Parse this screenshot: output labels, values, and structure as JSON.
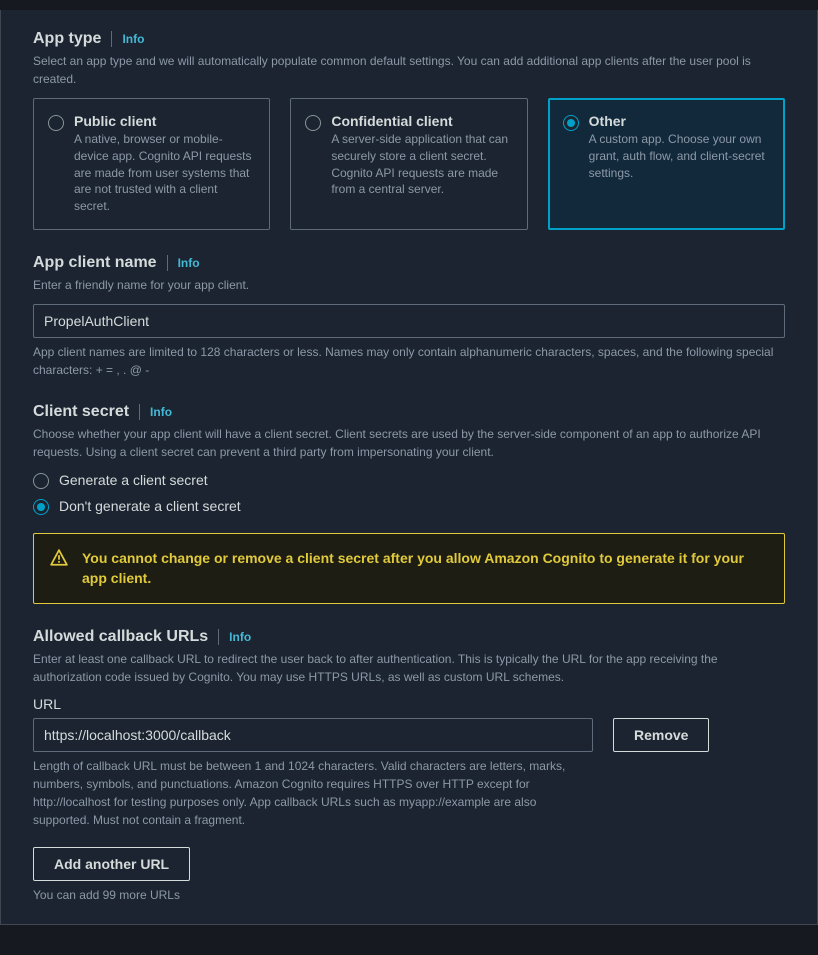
{
  "appType": {
    "title": "App type",
    "info": "Info",
    "desc": "Select an app type and we will automatically populate common default settings. You can add additional app clients after the user pool is created.",
    "options": [
      {
        "title": "Public client",
        "desc": "A native, browser or mobile-device app. Cognito API requests are made from user systems that are not trusted with a client secret.",
        "selected": false
      },
      {
        "title": "Confidential client",
        "desc": "A server-side application that can securely store a client secret. Cognito API requests are made from a central server.",
        "selected": false
      },
      {
        "title": "Other",
        "desc": "A custom app. Choose your own grant, auth flow, and client-secret settings.",
        "selected": true
      }
    ]
  },
  "appClientName": {
    "title": "App client name",
    "info": "Info",
    "desc": "Enter a friendly name for your app client.",
    "value": "PropelAuthClient",
    "helper": "App client names are limited to 128 characters or less. Names may only contain alphanumeric characters, spaces, and the following special characters: + = , . @ -"
  },
  "clientSecret": {
    "title": "Client secret",
    "info": "Info",
    "desc": "Choose whether your app client will have a client secret. Client secrets are used by the server-side component of an app to authorize API requests. Using a client secret can prevent a third party from impersonating your client.",
    "options": [
      {
        "label": "Generate a client secret",
        "selected": false
      },
      {
        "label": "Don't generate a client secret",
        "selected": true
      }
    ],
    "warning": "You cannot change or remove a client secret after you allow Amazon Cognito to generate it for your app client."
  },
  "callbackUrls": {
    "title": "Allowed callback URLs",
    "info": "Info",
    "desc": "Enter at least one callback URL to redirect the user back to after authentication. This is typically the URL for the app receiving the authorization code issued by Cognito. You may use HTTPS URLs, as well as custom URL schemes.",
    "urlLabel": "URL",
    "urlValue": "https://localhost:3000/callback",
    "removeLabel": "Remove",
    "helper": "Length of callback URL must be between 1 and 1024 characters. Valid characters are letters, marks, numbers, symbols, and punctuations. Amazon Cognito requires HTTPS over HTTP except for http://localhost for testing purposes only. App callback URLs such as myapp://example are also supported. Must not contain a fragment.",
    "addLabel": "Add another URL",
    "addHelper": "You can add 99 more URLs"
  }
}
